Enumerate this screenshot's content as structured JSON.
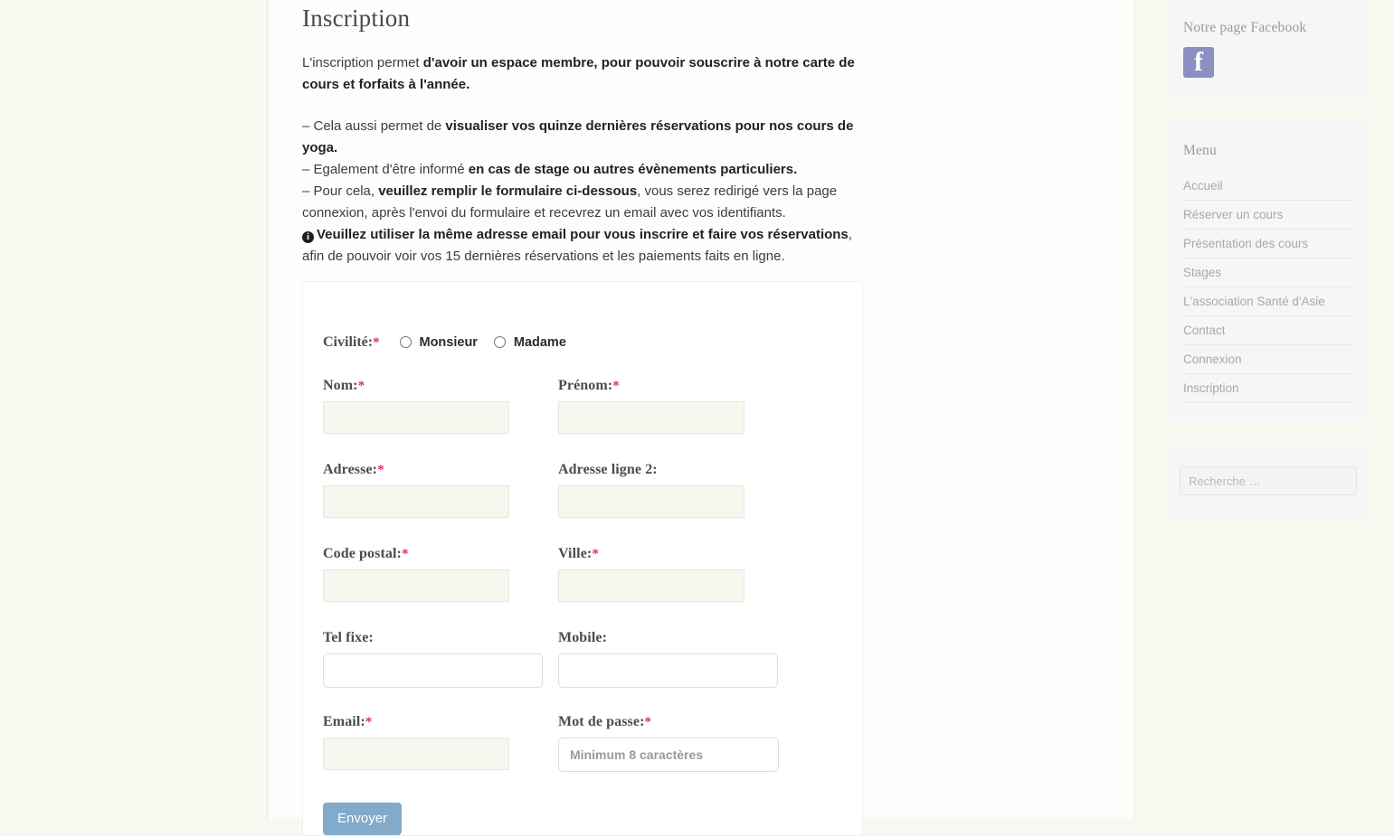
{
  "main": {
    "title": "Inscription",
    "intro": {
      "lead": "L'inscription permet ",
      "strong": "d'avoir un espace membre, pour pouvoir souscrire à notre carte de cours et forfaits à l'année."
    },
    "bullets": [
      {
        "lead": "– Cela aussi permet de ",
        "strong": "visualiser vos quinze dernières réservations pour nos cours de yoga.",
        "tail": ""
      },
      {
        "lead": "– Egalement d'être informé ",
        "strong": "en cas de stage ou autres évènements particuliers.",
        "tail": ""
      },
      {
        "lead": "– Pour cela, ",
        "strong": "veuillez remplir le formulaire ci-dessous",
        "tail": ", vous serez redirigé vers la page connexion, après l'envoi du formulaire et recevrez un email avec vos identifiants."
      },
      {
        "lead": "",
        "strong": "Veuillez utiliser la même adresse email pour vous inscrire et faire vos réservations",
        "tail": ", afin de pouvoir voir vos 15 dernières réservations et les paiements faits en ligne.",
        "icon": "info-circle-icon"
      }
    ]
  },
  "form": {
    "civility": {
      "label": "Civilité:",
      "required_mark": "*",
      "options": [
        {
          "label": "Monsieur",
          "value": "monsieur",
          "checked": false
        },
        {
          "label": "Madame",
          "value": "madame",
          "checked": false
        }
      ]
    },
    "fields": [
      {
        "name": "nom",
        "label": "Nom:",
        "required_mark": "*",
        "value": "",
        "placeholder": "",
        "style": "tinted"
      },
      {
        "name": "prenom",
        "label": "Prénom:",
        "required_mark": "*",
        "value": "",
        "placeholder": "",
        "style": "tinted"
      },
      {
        "name": "adresse",
        "label": "Adresse:",
        "required_mark": "*",
        "value": "",
        "placeholder": "",
        "style": "tinted"
      },
      {
        "name": "adresse-ligne-2",
        "label": "Adresse ligne 2:",
        "required_mark": "",
        "value": "",
        "placeholder": "",
        "style": "tinted"
      },
      {
        "name": "code-postal",
        "label": "Code postal:",
        "required_mark": "*",
        "value": "",
        "placeholder": "",
        "style": "tinted"
      },
      {
        "name": "ville",
        "label": "Ville:",
        "required_mark": "*",
        "value": "",
        "placeholder": "",
        "style": "tinted"
      },
      {
        "name": "tel-fixe",
        "label": "Tel fixe:",
        "required_mark": "",
        "value": "",
        "placeholder": "",
        "style": "wide"
      },
      {
        "name": "mobile",
        "label": "Mobile:",
        "required_mark": "",
        "value": "",
        "placeholder": "",
        "style": "wide"
      },
      {
        "name": "email",
        "label": "Email:",
        "required_mark": "*",
        "value": "",
        "placeholder": "",
        "style": "tinted"
      },
      {
        "name": "mot-de-passe",
        "label": "Mot de passe:",
        "required_mark": "*",
        "value": "",
        "placeholder": "Minimum 8 caractères",
        "style": "password"
      }
    ],
    "submit_label": "Envoyer"
  },
  "sidebar": {
    "facebook": {
      "title": "Notre page Facebook",
      "icon": "facebook-icon",
      "icon_color": "#8b90c2"
    },
    "menu": {
      "title": "Menu",
      "items": [
        {
          "label": "Accueil"
        },
        {
          "label": "Réserver un cours"
        },
        {
          "label": "Présentation des cours"
        },
        {
          "label": "Stages"
        },
        {
          "label": "L'association Santé d'Asie"
        },
        {
          "label": "Contact"
        },
        {
          "label": "Connexion"
        },
        {
          "label": "Inscription"
        }
      ]
    },
    "search": {
      "value": "",
      "placeholder": "Recherche …"
    }
  },
  "colors": {
    "accent_button": "#82aacb",
    "required_asterisk": "#e0314b",
    "page_background": "#f7f8f0",
    "content_background": "#fdfdfb",
    "widget_background": "#f6f6f6"
  }
}
